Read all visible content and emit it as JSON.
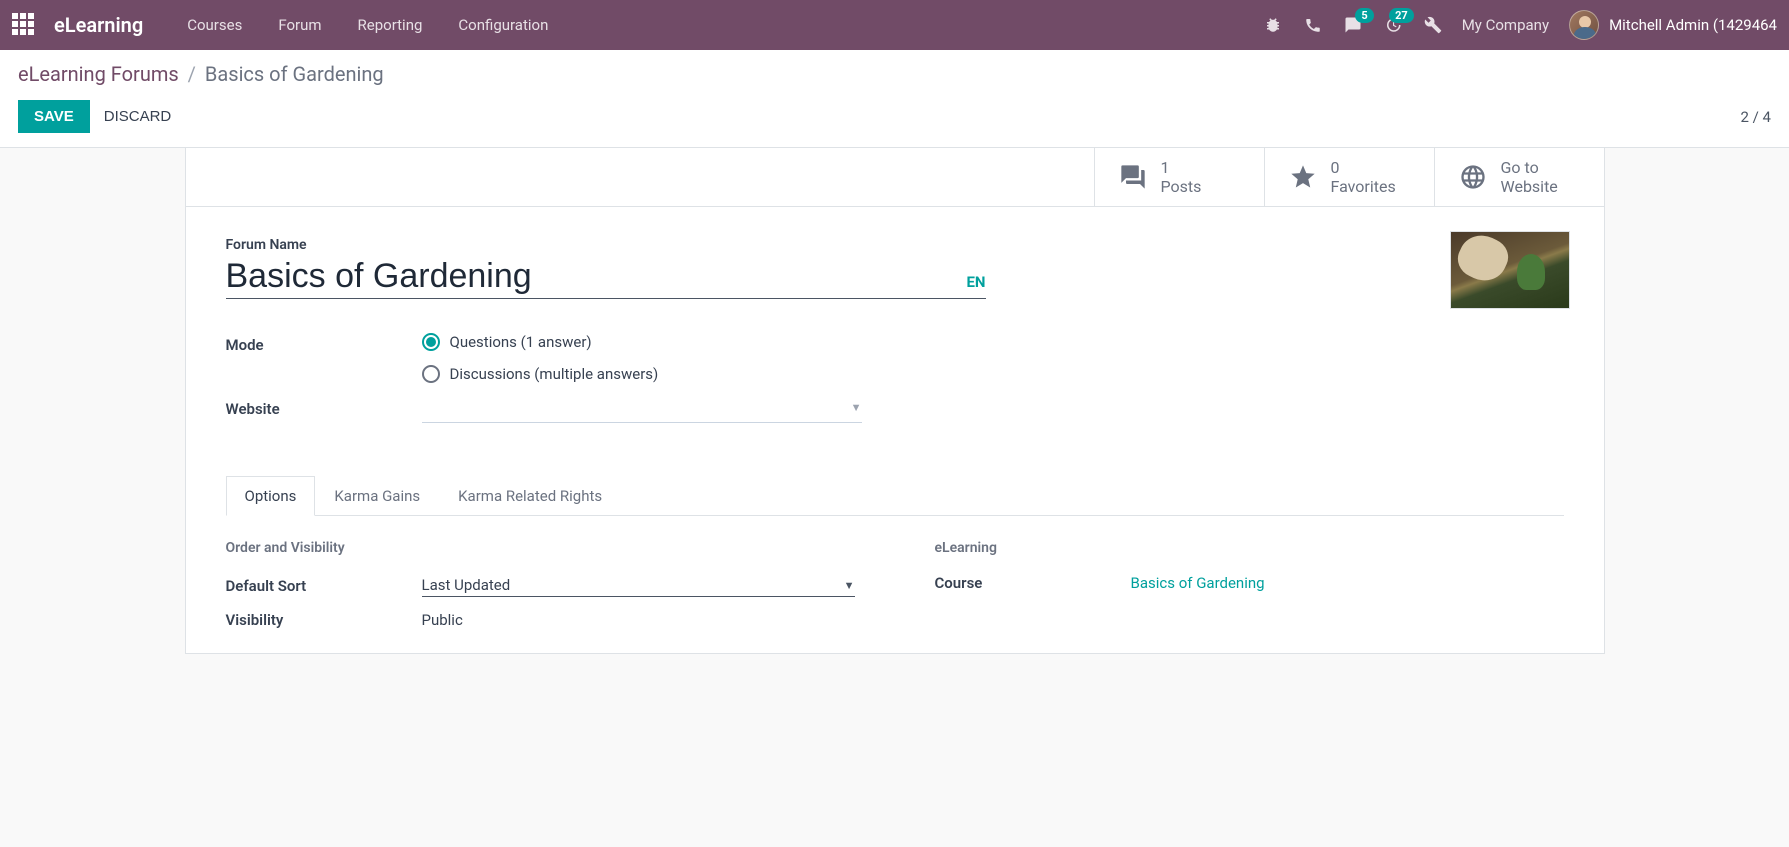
{
  "navbar": {
    "brand": "eLearning",
    "menu": [
      "Courses",
      "Forum",
      "Reporting",
      "Configuration"
    ],
    "messages_badge": "5",
    "activities_badge": "27",
    "company": "My Company",
    "user": "Mitchell Admin (1429464"
  },
  "breadcrumbs": {
    "parent": "eLearning Forums",
    "current": "Basics of Gardening"
  },
  "buttons": {
    "save": "SAVE",
    "discard": "DISCARD"
  },
  "pager": "2 / 4",
  "stat": {
    "posts_val": "1",
    "posts_lbl": "Posts",
    "fav_val": "0",
    "fav_lbl": "Favorites",
    "goto_l1": "Go to",
    "goto_l2": "Website"
  },
  "form": {
    "name_label": "Forum Name",
    "name_value": "Basics of Gardening",
    "lang": "EN",
    "mode_label": "Mode",
    "mode_options": {
      "questions": "Questions (1 answer)",
      "discussions": "Discussions (multiple answers)"
    },
    "website_label": "Website"
  },
  "tabs": [
    "Options",
    "Karma Gains",
    "Karma Related Rights"
  ],
  "options": {
    "left_title": "Order and Visibility",
    "default_sort_label": "Default Sort",
    "default_sort_value": "Last Updated",
    "visibility_label": "Visibility",
    "visibility_value": "Public",
    "right_title": "eLearning",
    "course_label": "Course",
    "course_value": "Basics of Gardening"
  }
}
